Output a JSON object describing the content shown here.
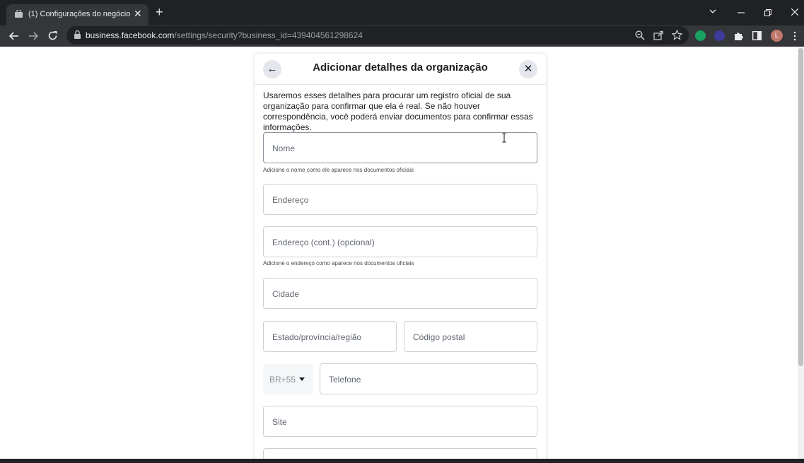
{
  "browser": {
    "tab_title": "(1) Configurações do negócio",
    "tab_close": "✕",
    "new_tab": "+",
    "url_host": "business.facebook.com",
    "url_path": "/settings/security?business_id=439404561298624",
    "avatar_letter": "L"
  },
  "modal": {
    "title": "Adicionar detalhes da organização",
    "back": "←",
    "close": "✕",
    "description": "Usaremos esses detalhes para procurar um registro oficial de sua organização para confirmar que ela é real. Se não houver correspondência, você poderá enviar documentos para confirmar essas informações.",
    "fields": {
      "name": "Nome",
      "name_hint": "Adicione o nome como ele aparece nos documentos oficiais",
      "address": "Endereço",
      "address2": "Endereço (cont.) (opcional)",
      "address_hint": "Adicione o endereço como aparece nos documentos oficiais",
      "city": "Cidade",
      "state": "Estado/província/região",
      "postal": "Código postal",
      "country_code": "BR+55",
      "phone": "Telefone",
      "site": "Site"
    }
  },
  "colors": {
    "chrome_dark": "#202124",
    "chrome_toolbar": "#35363a",
    "field_border": "#ccd0d5",
    "text_primary": "#1c1e21"
  }
}
